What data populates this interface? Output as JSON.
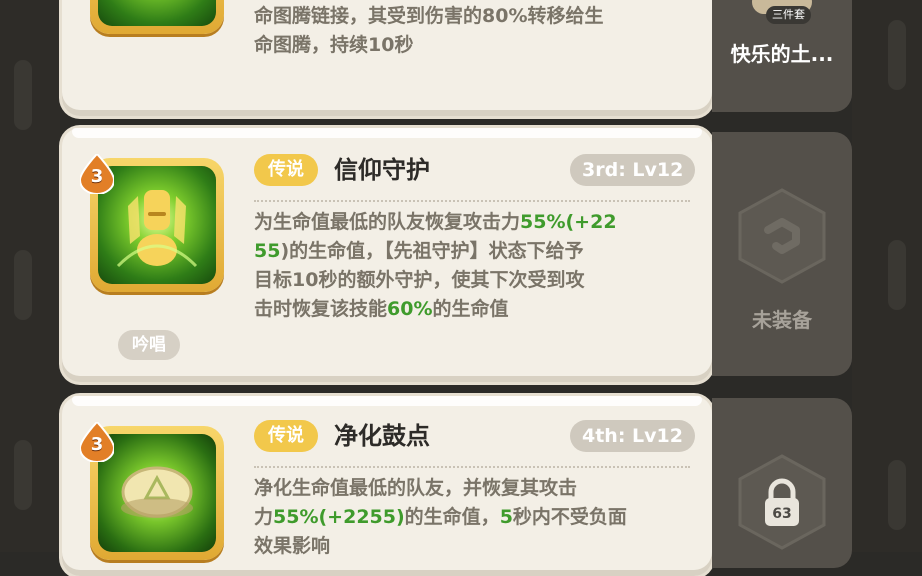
{
  "top_card": {
    "desc_line1": "命图腾链接，其受到伤害的80%转移给生",
    "desc_line2": "命图腾，持续10秒"
  },
  "top_side": {
    "set_badge": "三件套",
    "label": "快乐的土..."
  },
  "skills": [
    {
      "level_badge": "3",
      "rarity": "传说",
      "title": "信仰守护",
      "slot_level": "3rd: Lv12",
      "desc": [
        [
          "为生命值最低的队友恢复攻击力",
          "55%(+22"
        ],
        [
          "55",
          ")的生命值，【先祖守护】状态下给予"
        ],
        [
          "目标10秒的额外守护，使其下次受到攻"
        ],
        [
          "击时恢复该技能",
          "60%",
          "的生命值"
        ]
      ],
      "tag": "吟唱",
      "side_label": "未装备",
      "icon": "totem-heal-icon",
      "side_icon": "unequipped-hex-icon"
    },
    {
      "level_badge": "3",
      "rarity": "传说",
      "title": "净化鼓点",
      "slot_level": "4th: Lv12",
      "desc": [
        [
          "净化生命值最低的队友，并恢复其攻击"
        ],
        [
          "力",
          "55%(+2255)",
          "的生命值，",
          "5",
          "秒内不受负面"
        ],
        [
          "效果影响"
        ]
      ],
      "lock_level": "63",
      "icon": "drum-cleanse-icon",
      "side_icon": "lock-icon"
    }
  ],
  "colors": {
    "card_bg": "#f3efe6",
    "rarity_badge": "#f2c84b",
    "highlight_green": "#3f9b2c",
    "side_panel": "#54504a"
  }
}
